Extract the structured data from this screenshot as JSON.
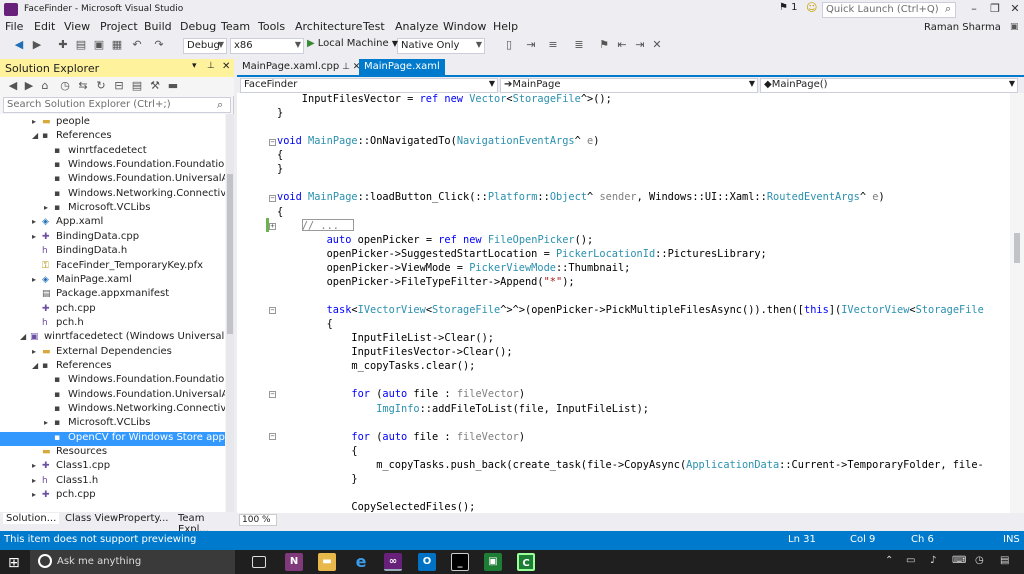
{
  "window": {
    "title": "FaceFinder - Microsoft Visual Studio"
  },
  "titlebar_right": {
    "notifications": "1",
    "quick_launch_placeholder": "Quick Launch (Ctrl+Q)",
    "user": "Raman Sharma"
  },
  "menu": [
    "File",
    "Edit",
    "View",
    "Project",
    "Build",
    "Debug",
    "Team",
    "Tools",
    "Architecture",
    "Test",
    "Analyze",
    "Window",
    "Help"
  ],
  "toolbar": {
    "configuration": "Debug",
    "platform": "x86",
    "run_target": "Local Machine",
    "filter": "Native Only"
  },
  "solution_explorer": {
    "title": "Solution Explorer",
    "search_placeholder": "Search Solution Explorer (Ctrl+;)",
    "tree": [
      {
        "label": "people",
        "icon": "folder-icon",
        "indent": 1,
        "expander": "▸"
      },
      {
        "label": "References",
        "icon": "references-icon",
        "indent": 1,
        "expander": "◢"
      },
      {
        "label": "winrtfacedetect",
        "icon": "reference-icon",
        "indent": 2,
        "expander": ""
      },
      {
        "label": "Windows.Foundation.FoundationCo",
        "icon": "reference-icon",
        "indent": 2,
        "expander": ""
      },
      {
        "label": "Windows.Foundation.UniversalApiC",
        "icon": "reference-icon",
        "indent": 2,
        "expander": ""
      },
      {
        "label": "Windows.Networking.Connectivity.W",
        "icon": "reference-icon",
        "indent": 2,
        "expander": ""
      },
      {
        "label": "Microsoft.VCLibs",
        "icon": "reference-icon",
        "indent": 2,
        "expander": "▸"
      },
      {
        "label": "App.xaml",
        "icon": "xaml-icon",
        "indent": 1,
        "expander": "▸"
      },
      {
        "label": "BindingData.cpp",
        "icon": "cpp-file-icon",
        "indent": 1,
        "expander": "▸"
      },
      {
        "label": "BindingData.h",
        "icon": "header-file-icon",
        "indent": 1,
        "expander": ""
      },
      {
        "label": "FaceFinder_TemporaryKey.pfx",
        "icon": "key-icon",
        "indent": 1,
        "expander": ""
      },
      {
        "label": "MainPage.xaml",
        "icon": "xaml-icon",
        "indent": 1,
        "expander": "▸"
      },
      {
        "label": "Package.appxmanifest",
        "icon": "manifest-icon",
        "indent": 1,
        "expander": ""
      },
      {
        "label": "pch.cpp",
        "icon": "cpp-file-icon",
        "indent": 1,
        "expander": ""
      },
      {
        "label": "pch.h",
        "icon": "header-file-icon",
        "indent": 1,
        "expander": ""
      },
      {
        "label": "winrtfacedetect (Windows Universal)",
        "icon": "project-icon",
        "indent": 0,
        "expander": "◢"
      },
      {
        "label": "External Dependencies",
        "icon": "folder-icon",
        "indent": 1,
        "expander": "▸"
      },
      {
        "label": "References",
        "icon": "references-icon",
        "indent": 1,
        "expander": "◢"
      },
      {
        "label": "Windows.Foundation.FoundationCo",
        "icon": "reference-icon",
        "indent": 2,
        "expander": ""
      },
      {
        "label": "Windows.Foundation.UniversalApiC",
        "icon": "reference-icon",
        "indent": 2,
        "expander": ""
      },
      {
        "label": "Windows.Networking.Connectivity.W",
        "icon": "reference-icon",
        "indent": 2,
        "expander": ""
      },
      {
        "label": "Microsoft.VCLibs",
        "icon": "reference-icon",
        "indent": 2,
        "expander": "▸"
      },
      {
        "label": "OpenCV for Windows Store apps - V",
        "icon": "reference-icon",
        "indent": 2,
        "expander": "",
        "selected": true
      },
      {
        "label": "Resources",
        "icon": "folder-icon",
        "indent": 1,
        "expander": ""
      },
      {
        "label": "Class1.cpp",
        "icon": "cpp-file-icon",
        "indent": 1,
        "expander": "▸"
      },
      {
        "label": "Class1.h",
        "icon": "header-file-icon",
        "indent": 1,
        "expander": "▸"
      },
      {
        "label": "pch.cpp",
        "icon": "cpp-file-icon",
        "indent": 1,
        "expander": "▸"
      }
    ],
    "bottom_tabs": [
      "Solution...",
      "Class View",
      "Property...",
      "Team Expl..."
    ]
  },
  "editor": {
    "tabs": [
      {
        "label": "MainPage.xaml.cpp",
        "active": false
      },
      {
        "label": "MainPage.xaml",
        "active": true
      }
    ],
    "nav": {
      "project": "FaceFinder",
      "scope": "MainPage",
      "member": "MainPage()"
    },
    "zoom": "100 %",
    "lines": [
      [
        [
          "    InputFilesVector = ",
          "n"
        ],
        [
          "ref",
          "kw"
        ],
        [
          " ",
          "n"
        ],
        [
          "new",
          "kw"
        ],
        [
          " ",
          "n"
        ],
        [
          "Vector",
          "ty"
        ],
        [
          "<",
          "n"
        ],
        [
          "StorageFile",
          "ty"
        ],
        [
          "^>();",
          "n"
        ]
      ],
      [
        [
          "}",
          "n"
        ]
      ],
      [
        [
          "",
          "n"
        ]
      ],
      [
        [
          "void",
          "kw"
        ],
        [
          " ",
          "n"
        ],
        [
          "MainPage",
          "ty"
        ],
        [
          "::OnNavigatedTo(",
          "n"
        ],
        [
          "NavigationEventArgs",
          "ty"
        ],
        [
          "^ ",
          "n"
        ],
        [
          "e",
          "pm"
        ],
        [
          ")",
          "n"
        ]
      ],
      [
        [
          "{",
          "n"
        ]
      ],
      [
        [
          "}",
          "n"
        ]
      ],
      [
        [
          "",
          "n"
        ]
      ],
      [
        [
          "void",
          "kw"
        ],
        [
          " ",
          "n"
        ],
        [
          "MainPage",
          "ty"
        ],
        [
          "::loadButton_Click(::",
          "n"
        ],
        [
          "Platform",
          "ty"
        ],
        [
          "::",
          "n"
        ],
        [
          "Object",
          "ty"
        ],
        [
          "^ ",
          "n"
        ],
        [
          "sender",
          "pm"
        ],
        [
          ", Windows::UI::Xaml::",
          "n"
        ],
        [
          "RoutedEventArgs",
          "ty"
        ],
        [
          "^ ",
          "n"
        ],
        [
          "e",
          "pm"
        ],
        [
          ")",
          "n"
        ]
      ],
      [
        [
          "{",
          "n"
        ]
      ],
      [
        [
          "    ",
          "n"
        ],
        [
          "// ...",
          "pm"
        ]
      ],
      [
        [
          "        ",
          "n"
        ],
        [
          "auto",
          "kw"
        ],
        [
          " openPicker = ",
          "n"
        ],
        [
          "ref",
          "kw"
        ],
        [
          " ",
          "n"
        ],
        [
          "new",
          "kw"
        ],
        [
          " ",
          "n"
        ],
        [
          "FileOpenPicker",
          "ty"
        ],
        [
          "();",
          "n"
        ]
      ],
      [
        [
          "        openPicker->SuggestedStartLocation = ",
          "n"
        ],
        [
          "PickerLocationId",
          "ty"
        ],
        [
          "::PicturesLibrary;",
          "n"
        ]
      ],
      [
        [
          "        openPicker->ViewMode = ",
          "n"
        ],
        [
          "PickerViewMode",
          "ty"
        ],
        [
          "::Thumbnail;",
          "n"
        ]
      ],
      [
        [
          "        openPicker->FileTypeFilter->Append(",
          "n"
        ],
        [
          "\"*\"",
          "st"
        ],
        [
          ");",
          "n"
        ]
      ],
      [
        [
          "",
          "n"
        ]
      ],
      [
        [
          "        ",
          "n"
        ],
        [
          "task",
          "kw"
        ],
        [
          "<",
          "n"
        ],
        [
          "IVectorView",
          "ty"
        ],
        [
          "<",
          "n"
        ],
        [
          "StorageFile",
          "ty"
        ],
        [
          "^>^>(openPicker->PickMultipleFilesAsync()).then([",
          "n"
        ],
        [
          "this",
          "kw"
        ],
        [
          "](",
          "n"
        ],
        [
          "IVectorView",
          "ty"
        ],
        [
          "<",
          "n"
        ],
        [
          "StorageFile",
          "ty"
        ]
      ],
      [
        [
          "        {",
          "n"
        ]
      ],
      [
        [
          "            InputFileList->Clear();",
          "n"
        ]
      ],
      [
        [
          "            InputFilesVector->Clear();",
          "n"
        ]
      ],
      [
        [
          "            m_copyTasks.clear();",
          "n"
        ]
      ],
      [
        [
          "",
          "n"
        ]
      ],
      [
        [
          "            ",
          "n"
        ],
        [
          "for",
          "kw"
        ],
        [
          " (",
          "n"
        ],
        [
          "auto",
          "kw"
        ],
        [
          " file : ",
          "n"
        ],
        [
          "fileVector",
          "pm"
        ],
        [
          ")",
          "n"
        ]
      ],
      [
        [
          "                ",
          "n"
        ],
        [
          "ImgInfo",
          "ty"
        ],
        [
          "::addFileToList(file, InputFileList);",
          "n"
        ]
      ],
      [
        [
          "",
          "n"
        ]
      ],
      [
        [
          "            ",
          "n"
        ],
        [
          "for",
          "kw"
        ],
        [
          " (",
          "n"
        ],
        [
          "auto",
          "kw"
        ],
        [
          " file : ",
          "n"
        ],
        [
          "fileVector",
          "pm"
        ],
        [
          ")",
          "n"
        ]
      ],
      [
        [
          "            {",
          "n"
        ]
      ],
      [
        [
          "                m_copyTasks.push_back(create_task(file->CopyAsync(",
          "n"
        ],
        [
          "ApplicationData",
          "ty"
        ],
        [
          "::Current->TemporaryFolder, file-",
          "n"
        ]
      ],
      [
        [
          "            }",
          "n"
        ]
      ],
      [
        [
          "",
          "n"
        ]
      ],
      [
        [
          "            CopySelectedFiles();",
          "n"
        ]
      ]
    ]
  },
  "statusbar": {
    "message": "This item does not support previewing",
    "line": "Ln 31",
    "col": "Col 9",
    "ch": "Ch 6",
    "mode": "INS"
  },
  "taskbar": {
    "search_placeholder": "Ask me anything"
  }
}
